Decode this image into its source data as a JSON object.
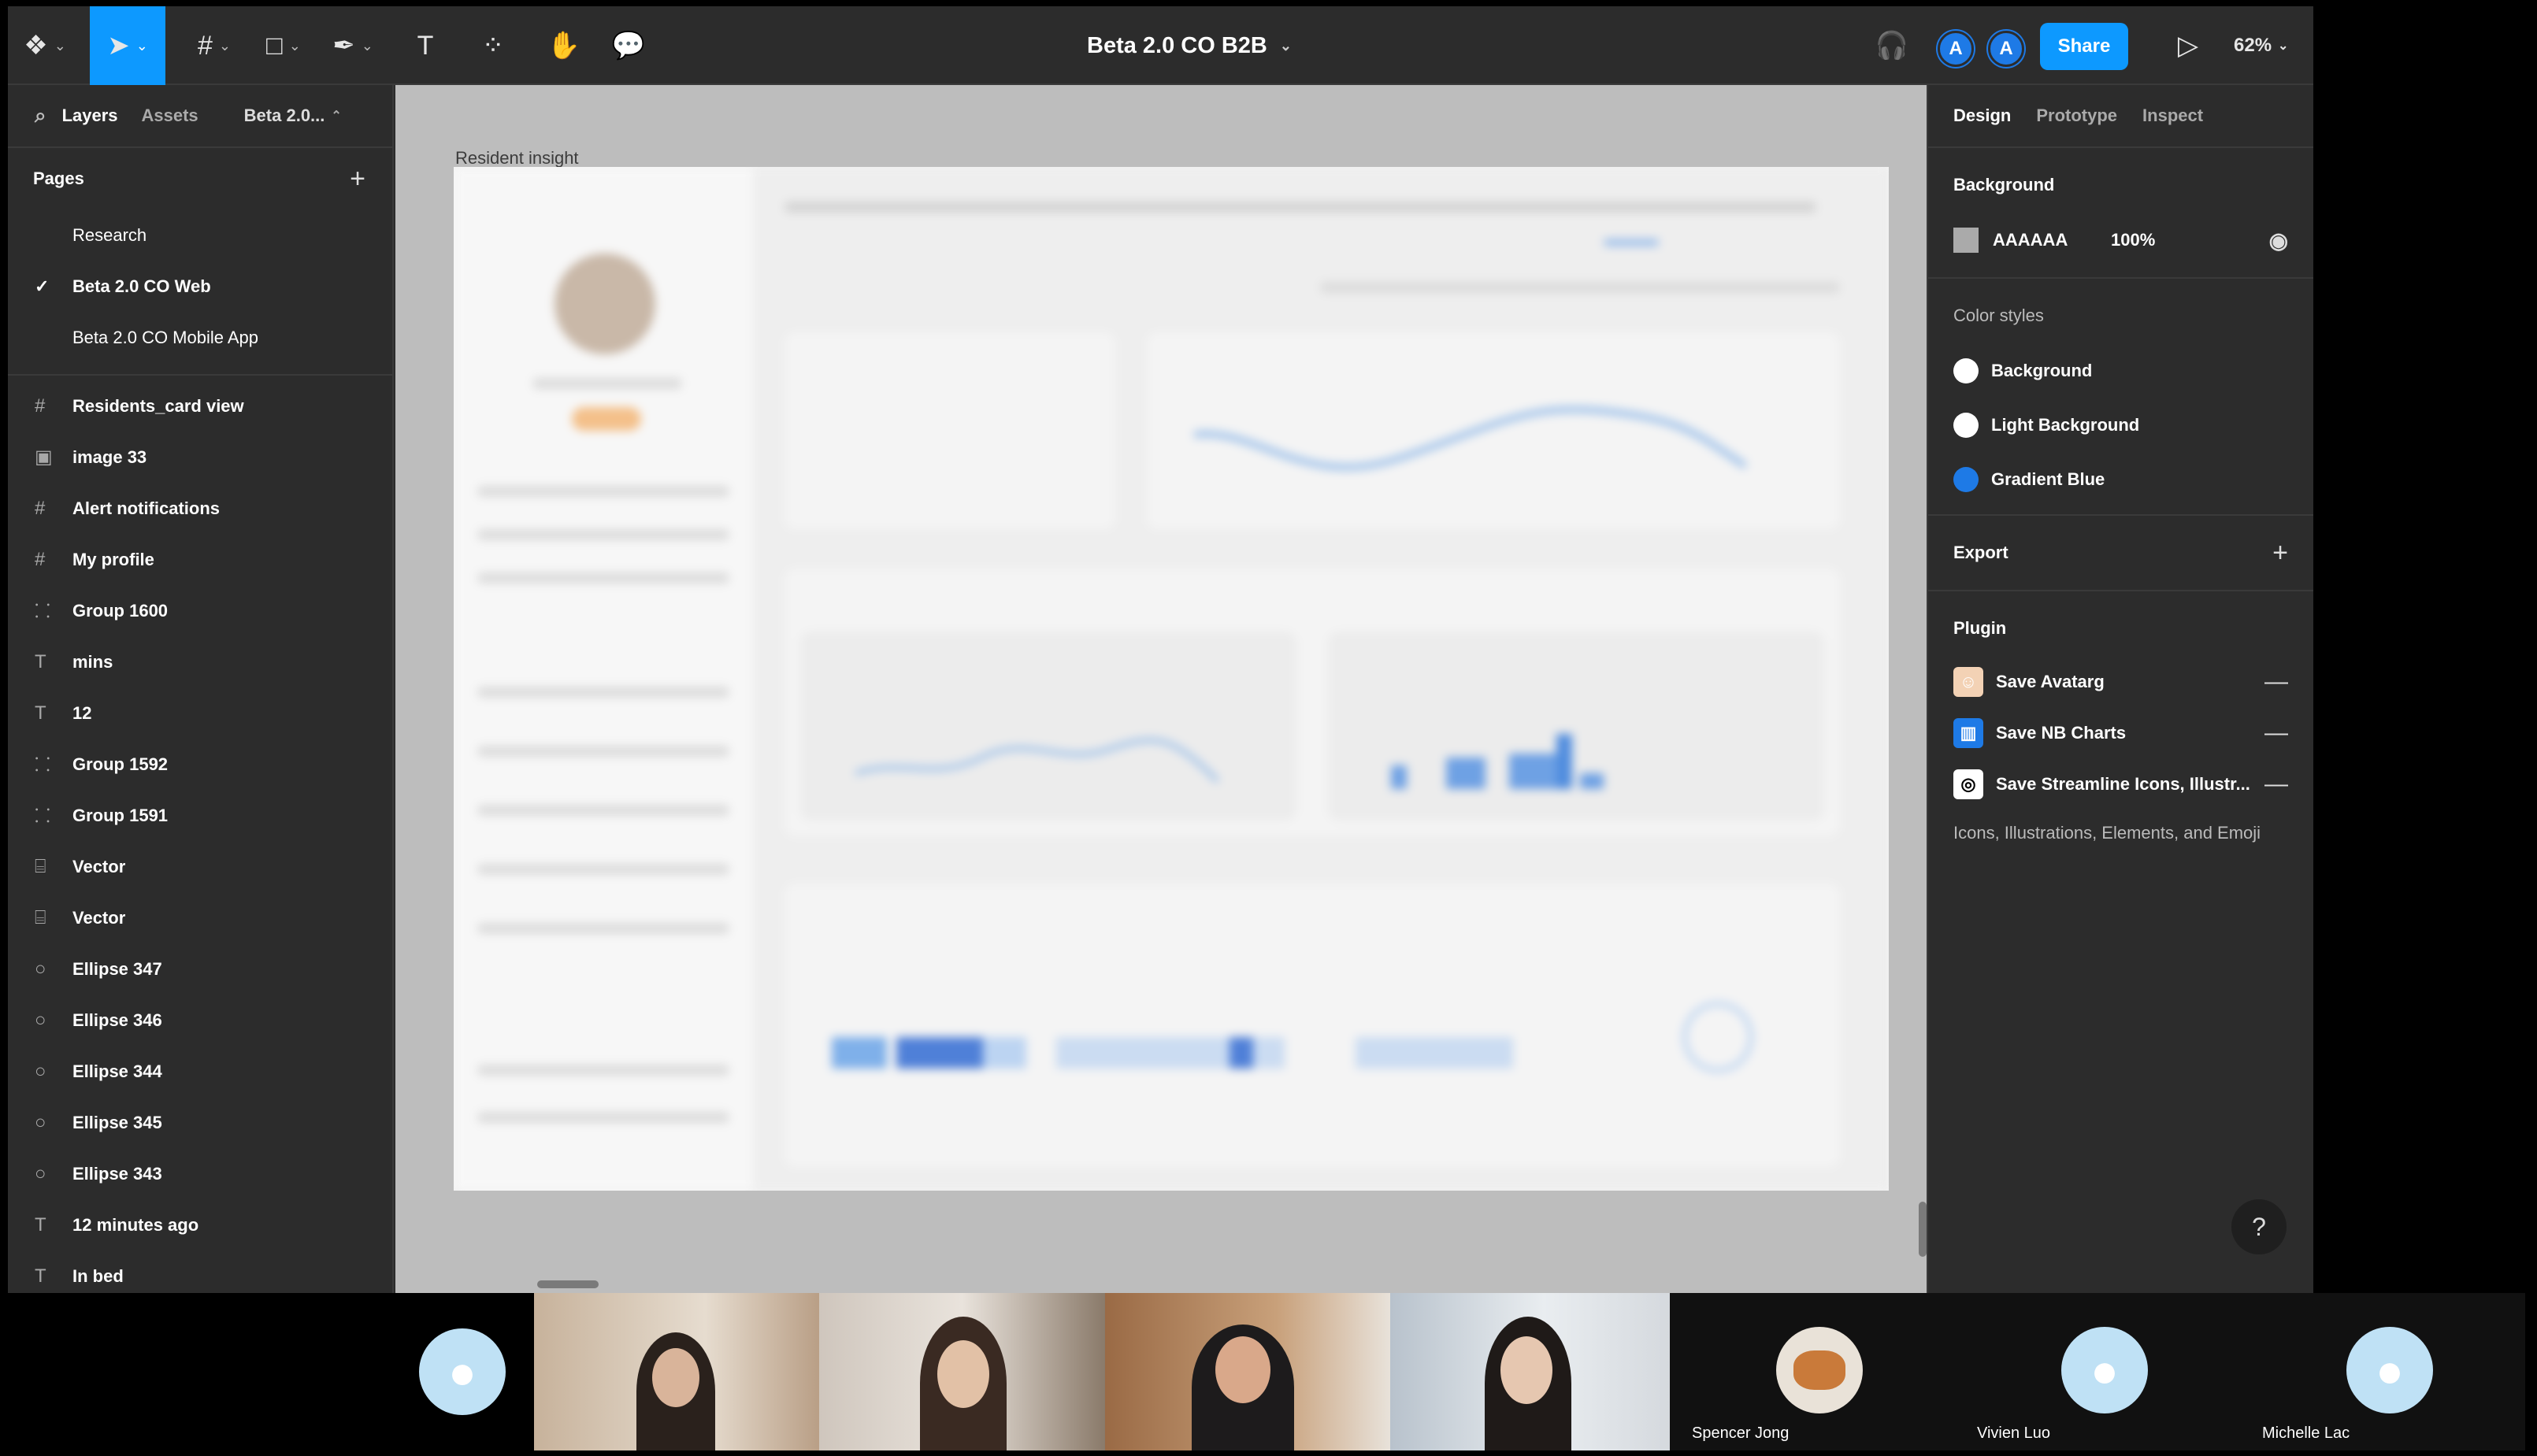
{
  "toolbar": {
    "title": "Beta 2.0 CO B2B",
    "share_label": "Share",
    "zoom": "62%",
    "collaborators": [
      "A",
      "A"
    ]
  },
  "left_panel": {
    "tabs": {
      "layers": "Layers",
      "assets": "Assets",
      "page_selector": "Beta 2.0..."
    },
    "pages_title": "Pages",
    "pages": [
      {
        "label": "Research",
        "selected": false
      },
      {
        "label": "Beta 2.0 CO Web",
        "selected": true
      },
      {
        "label": "Beta 2.0 CO Mobile App",
        "selected": false
      }
    ],
    "layers": [
      {
        "label": "Residents_card view",
        "icon": "frame-icon"
      },
      {
        "label": "image 33",
        "icon": "image-icon"
      },
      {
        "label": "Alert notifications",
        "icon": "frame-icon"
      },
      {
        "label": "My profile",
        "icon": "frame-icon"
      },
      {
        "label": "Group 1600",
        "icon": "group-icon"
      },
      {
        "label": "mins",
        "icon": "text-icon"
      },
      {
        "label": "12",
        "icon": "text-icon"
      },
      {
        "label": "Group 1592",
        "icon": "group-icon"
      },
      {
        "label": "Group 1591",
        "icon": "group-icon"
      },
      {
        "label": "Vector",
        "icon": "vector-icon"
      },
      {
        "label": "Vector",
        "icon": "vector-icon"
      },
      {
        "label": "Ellipse 347",
        "icon": "ellipse-icon"
      },
      {
        "label": "Ellipse 346",
        "icon": "ellipse-icon"
      },
      {
        "label": "Ellipse 344",
        "icon": "ellipse-icon"
      },
      {
        "label": "Ellipse 345",
        "icon": "ellipse-icon"
      },
      {
        "label": "Ellipse 343",
        "icon": "ellipse-icon"
      },
      {
        "label": "12 minutes ago",
        "icon": "text-icon"
      },
      {
        "label": "In bed",
        "icon": "text-icon"
      }
    ]
  },
  "canvas": {
    "frame_label": "Resident insight",
    "background": "#bdbdbd"
  },
  "right_panel": {
    "tabs": {
      "design": "Design",
      "prototype": "Prototype",
      "inspect": "Inspect"
    },
    "background": {
      "title": "Background",
      "hex": "AAAAAA",
      "opacity": "100%"
    },
    "color_styles": {
      "title": "Color styles",
      "items": [
        {
          "label": "Background",
          "color": "#ffffff"
        },
        {
          "label": "Light Background",
          "color": "#ffffff"
        },
        {
          "label": "Gradient Blue",
          "color": "#1e7ae6"
        }
      ]
    },
    "export_title": "Export",
    "plugin": {
      "title": "Plugin",
      "items": [
        {
          "label": "Save Avatarg"
        },
        {
          "label": "Save NB Charts"
        },
        {
          "label": "Save Streamline Icons, Illustr..."
        }
      ],
      "description": "Icons, Illustrations, Elements, and Emoji"
    },
    "help": "?"
  },
  "video": {
    "participants": [
      {
        "name": ""
      },
      {
        "name": ""
      },
      {
        "name": ""
      },
      {
        "name": ""
      },
      {
        "name": ""
      },
      {
        "name": "Spencer Jong"
      },
      {
        "name": "Vivien Luo"
      },
      {
        "name": "Michelle Lac"
      }
    ]
  }
}
